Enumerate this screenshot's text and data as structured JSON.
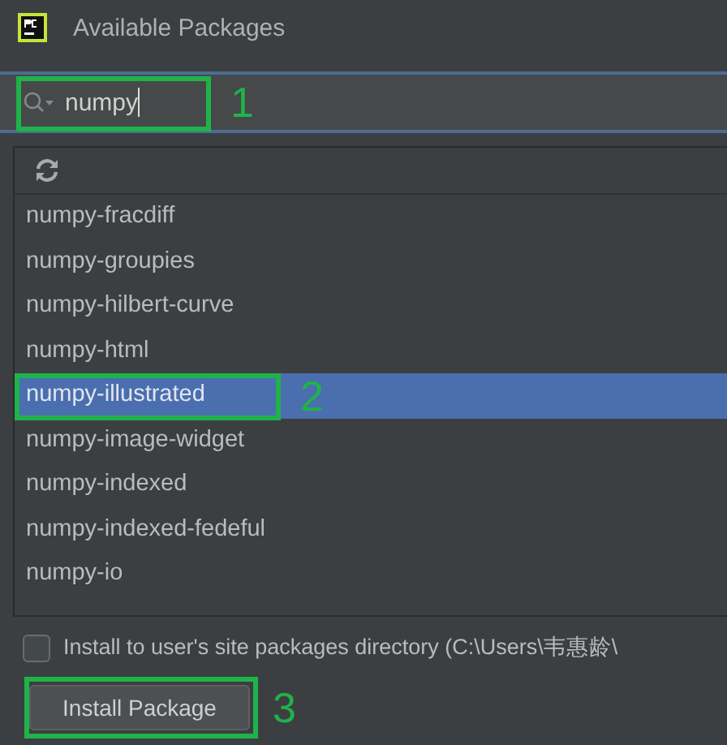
{
  "window": {
    "title": "Available Packages"
  },
  "search": {
    "value": "numpy",
    "annotation": "1"
  },
  "packages": [
    {
      "name": "numpy-fracdiff",
      "selected": false
    },
    {
      "name": "numpy-groupies",
      "selected": false
    },
    {
      "name": "numpy-hilbert-curve",
      "selected": false
    },
    {
      "name": "numpy-html",
      "selected": false
    },
    {
      "name": "numpy-illustrated",
      "selected": true,
      "annotation": "2"
    },
    {
      "name": "numpy-image-widget",
      "selected": false
    },
    {
      "name": "numpy-indexed",
      "selected": false
    },
    {
      "name": "numpy-indexed-fedeful",
      "selected": false
    },
    {
      "name": "numpy-io",
      "selected": false
    }
  ],
  "user_site_option": {
    "label": "Install to user's site packages directory (C:\\Users\\韦惠龄\\",
    "checked": false
  },
  "install_button": {
    "label": "Install Package",
    "annotation": "3"
  }
}
